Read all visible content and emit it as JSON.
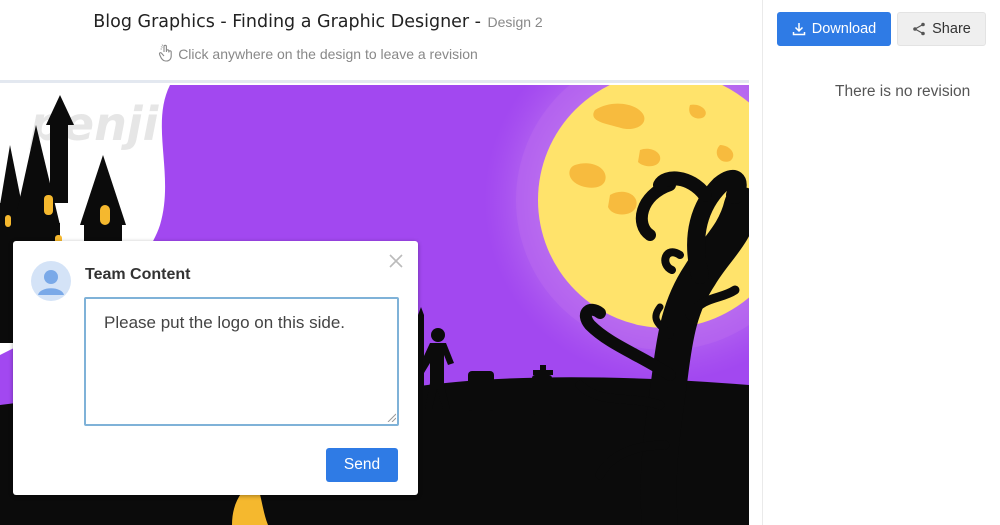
{
  "header": {
    "title": "Blog Graphics - Finding a Graphic Designer -",
    "version": "Design 2",
    "hint": "Click anywhere on the design to leave a revision",
    "hint_icon": "hand-pointer-icon"
  },
  "toolbar": {
    "download_label": "Download",
    "download_icon": "download-icon",
    "share_label": "Share",
    "share_icon": "share-icon"
  },
  "revisions": {
    "empty_text": "There is no revision"
  },
  "design": {
    "watermark": "penji",
    "colors": {
      "purple": "#a248f0",
      "moon": "#ffe36b",
      "moon_spots": "#f7bb3e",
      "silhouette": "#0b0b0b"
    }
  },
  "comment": {
    "author": "Team Content",
    "text": "Please put the logo on this side.",
    "send_label": "Send",
    "close_icon": "close-icon",
    "avatar_icon": "user-avatar-icon"
  },
  "annotation": {
    "arrow_color": "#e02020"
  },
  "colors": {
    "accent": "#2f7be5",
    "input_border": "#7fb2d8"
  }
}
